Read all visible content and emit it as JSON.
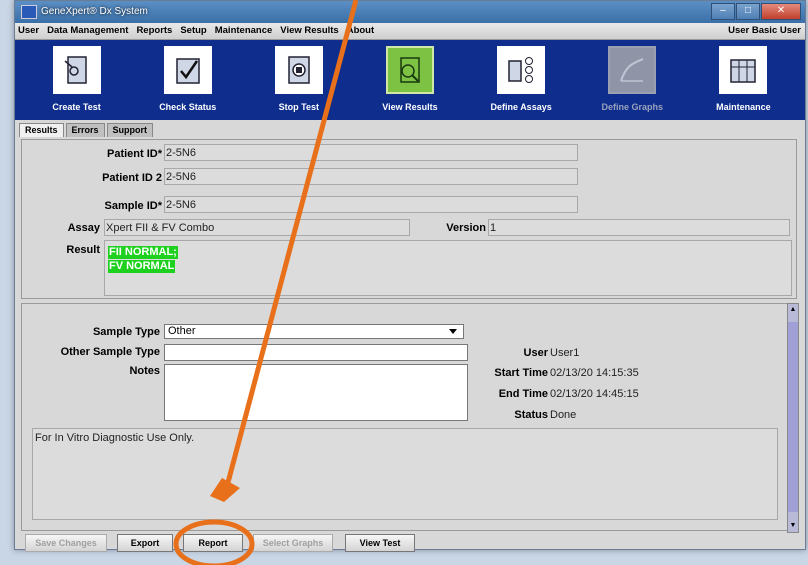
{
  "window": {
    "title": "GeneXpert® Dx System"
  },
  "menu": {
    "items": [
      "User",
      "Data Management",
      "Reports",
      "Setup",
      "Maintenance",
      "View Results",
      "About"
    ],
    "user_label": "User Basic User"
  },
  "toolbar": {
    "items": [
      {
        "label": "Create Test",
        "icon": "create-test-icon"
      },
      {
        "label": "Check Status",
        "icon": "check-status-icon"
      },
      {
        "label": "Stop Test",
        "icon": "stop-test-icon"
      },
      {
        "label": "View Results",
        "icon": "view-results-icon",
        "active": true
      },
      {
        "label": "Define Assays",
        "icon": "define-assays-icon"
      },
      {
        "label": "Define Graphs",
        "icon": "define-graphs-icon",
        "disabled": true
      },
      {
        "label": "Maintenance",
        "icon": "maintenance-icon"
      }
    ]
  },
  "tabs": [
    "Results",
    "Errors",
    "Support"
  ],
  "results": {
    "patient_id_label": "Patient ID*",
    "patient_id": "2-5N6",
    "patient_id2_label": "Patient ID 2",
    "patient_id2": "2-5N6",
    "sample_id_label": "Sample ID*",
    "sample_id": "2-5N6",
    "assay_label": "Assay",
    "assay": "Xpert FII & FV Combo",
    "version_label": "Version",
    "version": "1",
    "result_label": "Result",
    "result_line1": "FII NORMAL;",
    "result_line2": "FV NORMAL"
  },
  "details": {
    "sample_type_label": "Sample Type",
    "sample_type": "Other",
    "other_sample_type_label": "Other Sample Type",
    "other_sample_type": "",
    "notes_label": "Notes",
    "notes": "",
    "user_label": "User",
    "user": "User1",
    "start_time_label": "Start Time",
    "start_time": "02/13/20 14:15:35",
    "end_time_label": "End Time",
    "end_time": "02/13/20 14:45:15",
    "status_label": "Status",
    "status": "Done",
    "disclaimer": "For In Vitro Diagnostic Use Only."
  },
  "buttons": {
    "save": "Save Changes",
    "export": "Export",
    "report": "Report",
    "select_graphs": "Select Graphs",
    "view_test": "View Test"
  },
  "colors": {
    "annotation": "#e8701a",
    "toolbar": "#0e2d8c",
    "result_bg": "#1fd11f"
  }
}
